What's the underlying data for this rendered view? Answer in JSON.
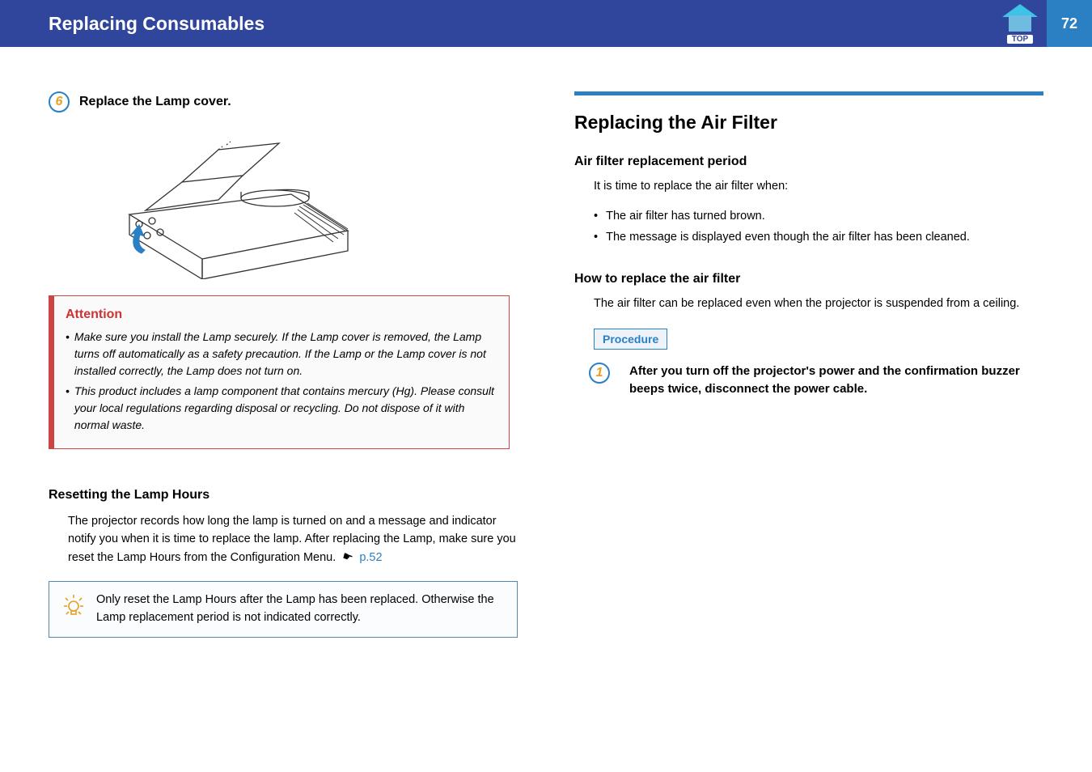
{
  "header": {
    "title": "Replacing Consumables",
    "top_label": "TOP",
    "page_number": "72"
  },
  "left": {
    "step6": {
      "num": "6",
      "text": "Replace the Lamp cover."
    },
    "attention": {
      "title": "Attention",
      "items": [
        "Make sure you install the Lamp securely. If the Lamp cover is removed, the Lamp turns off automatically as a safety precaution. If the Lamp or the Lamp cover is not installed correctly, the Lamp does not turn on.",
        "This product includes a lamp component that contains mercury (Hg). Please consult your local regulations regarding disposal or recycling. Do not dispose of it with normal waste."
      ]
    },
    "reset": {
      "heading": "Resetting the Lamp Hours",
      "body_pre": "The projector records how long the lamp is turned on and a message and indicator notify you when it is time to replace the lamp. After replacing the Lamp, make sure you reset the Lamp Hours from the Configuration Menu. ",
      "link": "p.52"
    },
    "tip": "Only reset the Lamp Hours after the Lamp has been replaced. Otherwise the Lamp replacement period is not indicated correctly."
  },
  "right": {
    "section_title": "Replacing the Air Filter",
    "sub1": "Air filter replacement period",
    "body1": "It is time to replace the air filter when:",
    "bullets": [
      "The air filter has turned brown.",
      "The message is displayed even though the air filter has been cleaned."
    ],
    "sub2": "How to replace the air filter",
    "body2": "The air filter can be replaced even when the projector is suspended from a ceiling.",
    "procedure_label": "Procedure",
    "step1": {
      "num": "1",
      "text": "After you turn off the projector's power and the confirmation buzzer beeps twice, disconnect the power cable."
    }
  }
}
